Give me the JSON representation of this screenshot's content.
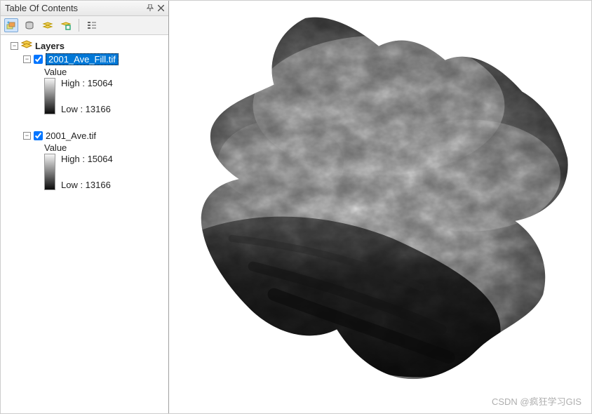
{
  "toc": {
    "title": "Table Of Contents",
    "pin_icon": "pin",
    "close_icon": "close",
    "toolbar": {
      "buttons": [
        {
          "name": "list-by-drawing-order",
          "active": true
        },
        {
          "name": "list-by-source",
          "active": false
        },
        {
          "name": "list-by-visibility",
          "active": false
        },
        {
          "name": "list-by-selection",
          "active": false
        }
      ],
      "options_button": "options"
    },
    "root": {
      "label": "Layers",
      "expanded": true,
      "children": [
        {
          "name": "2001_Ave_Fill.tif",
          "checked": true,
          "expanded": true,
          "selected": true,
          "value_label": "Value",
          "high_label": "High : 15064",
          "low_label": "Low : 13166"
        },
        {
          "name": "2001_Ave.tif",
          "checked": true,
          "expanded": true,
          "selected": false,
          "value_label": "Value",
          "high_label": "High : 15064",
          "low_label": "Low : 13166"
        }
      ]
    }
  },
  "watermark": "CSDN @疯狂学习GIS"
}
